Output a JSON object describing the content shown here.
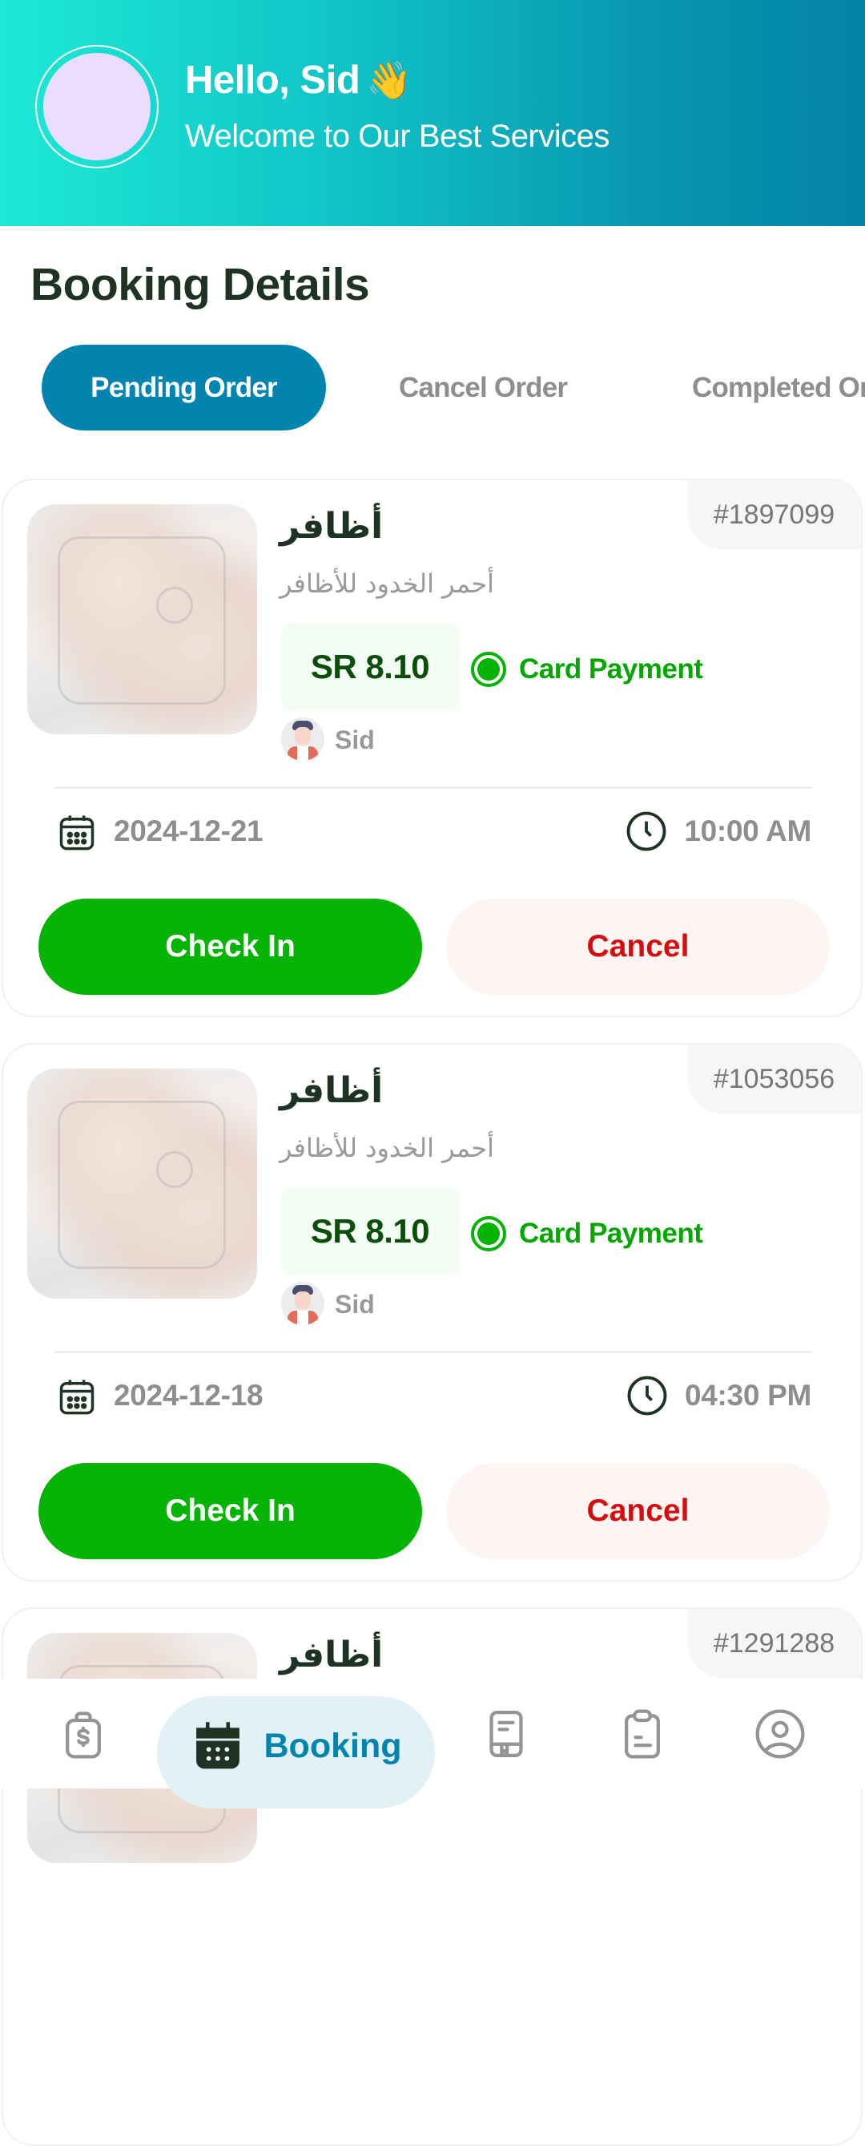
{
  "header": {
    "greeting": "Hello, Sid",
    "wave_emoji": "👋",
    "subtitle": "Welcome to Our Best Services",
    "avatar_icon": "user-avatar-placeholder"
  },
  "page_title": "Booking Details",
  "tabs": [
    {
      "label": "Pending Order",
      "active": true
    },
    {
      "label": "Cancel Order",
      "active": false
    },
    {
      "label": "Completed Order",
      "active": false
    }
  ],
  "bookings": [
    {
      "order_id": "#1897099",
      "service_title": "أظافر",
      "service_subtitle": "أحمر الخدود للأظافر",
      "price": "SR 8.10",
      "payment_method": "Card Payment",
      "customer_name": "Sid",
      "date": "2024-12-21",
      "time": "10:00 AM",
      "check_in_label": "Check In",
      "cancel_label": "Cancel"
    },
    {
      "order_id": "#1053056",
      "service_title": "أظافر",
      "service_subtitle": "أحمر الخدود للأظافر",
      "price": "SR 8.10",
      "payment_method": "Card Payment",
      "customer_name": "Sid",
      "date": "2024-12-18",
      "time": "04:30 PM",
      "check_in_label": "Check In",
      "cancel_label": "Cancel"
    },
    {
      "order_id": "#1291288",
      "service_title": "أظافر"
    }
  ],
  "bottom_nav": [
    {
      "icon": "money-bag-icon",
      "label": "",
      "active": false
    },
    {
      "icon": "calendar-icon",
      "label": "Booking",
      "active": true
    },
    {
      "icon": "book-icon",
      "label": "",
      "active": false
    },
    {
      "icon": "clipboard-icon",
      "label": "",
      "active": false
    },
    {
      "icon": "profile-icon",
      "label": "",
      "active": false
    }
  ],
  "colors": {
    "primary": "#0284af",
    "header_gradient_start": "#1de9d6",
    "header_gradient_end": "#0284a8",
    "success": "#05b304",
    "danger": "#d50d0d",
    "title_dark": "#1f3324"
  }
}
